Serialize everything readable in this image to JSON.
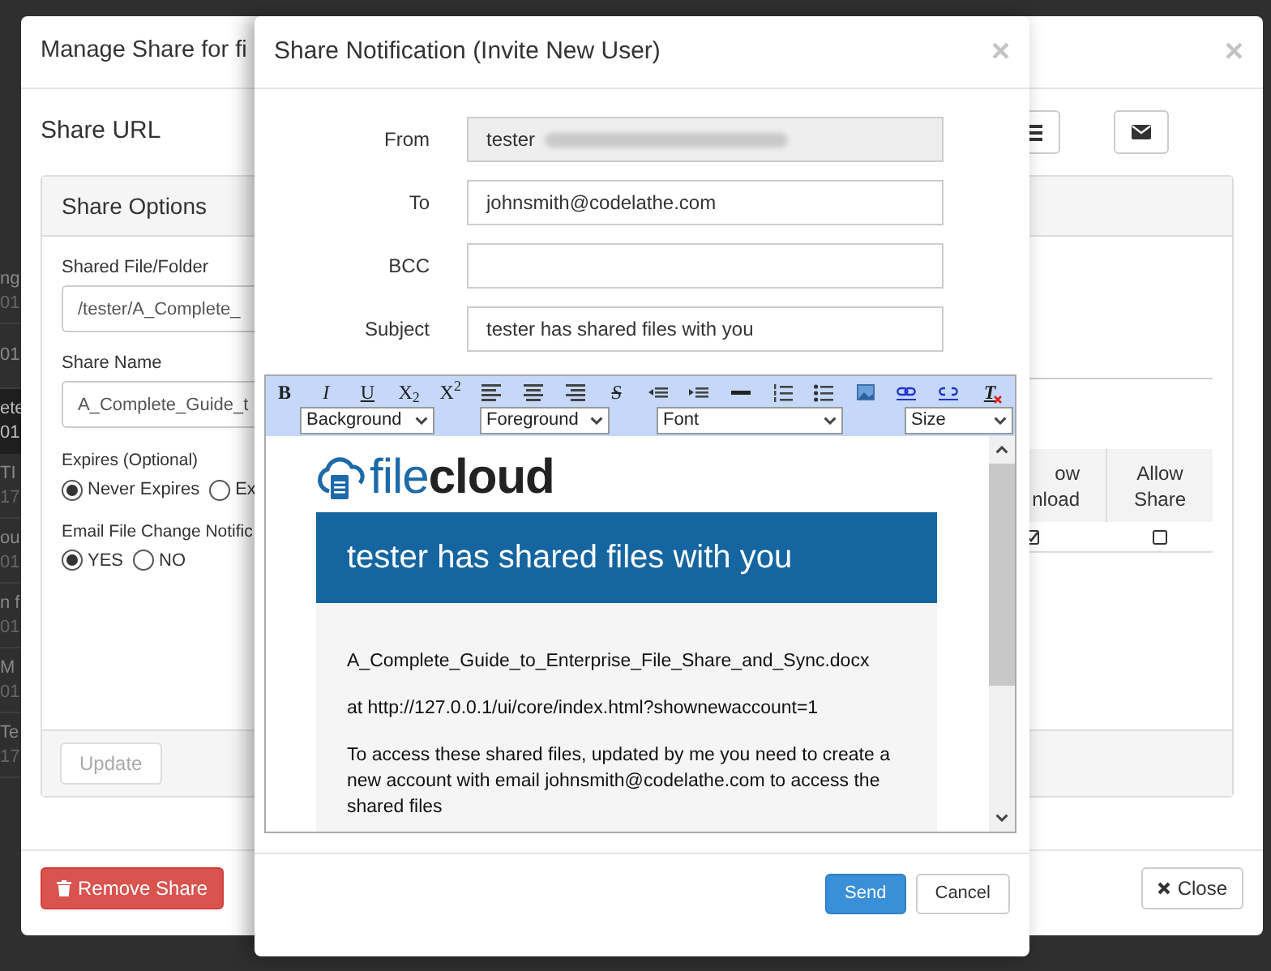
{
  "background_list": {
    "rows": [
      {
        "lines": [
          "ng",
          "01"
        ],
        "selected": false
      },
      {
        "lines": [
          "01"
        ],
        "selected": false
      },
      {
        "lines": [
          "ete",
          "01"
        ],
        "selected": true
      },
      {
        "lines": [
          "TI",
          "17"
        ],
        "selected": false
      },
      {
        "lines": [
          "ou",
          "01"
        ],
        "selected": false
      },
      {
        "lines": [
          "n f",
          "01"
        ],
        "selected": false
      },
      {
        "lines": [
          "M",
          "01"
        ],
        "selected": false
      },
      {
        "lines": [
          "Te",
          "17"
        ],
        "selected": false
      }
    ]
  },
  "manage_share": {
    "title": "Manage Share for fi",
    "close": "×",
    "share_url_label": "Share URL",
    "url_buttons": [
      {
        "kind": "list"
      },
      {
        "kind": "envelope"
      }
    ],
    "share_options": {
      "title": "Share Options",
      "fields": [
        {
          "label": "Shared File/Folder",
          "value": "/tester/A_Complete_"
        },
        {
          "label": "Share Name",
          "value": "A_Complete_Guide_t"
        }
      ],
      "radio_groups": [
        {
          "label": "Expires (Optional)",
          "options": [
            {
              "label": "Never Expires",
              "selected": true
            },
            {
              "label": "Ex",
              "selected": false
            }
          ]
        },
        {
          "label": "Email File Change Notific",
          "options": [
            {
              "label": "YES",
              "selected": true
            },
            {
              "label": "NO",
              "selected": false
            }
          ]
        }
      ],
      "permissions_table": {
        "columns": [
          {
            "lines": [
              "ow",
              "nload"
            ]
          },
          {
            "lines": [
              "Allow",
              "Share"
            ]
          }
        ],
        "row": [
          {
            "checked": true
          },
          {
            "checked": false
          }
        ]
      },
      "update_button": {
        "label": "Update",
        "disabled": true
      }
    },
    "remove_button": "Remove Share",
    "close_button": "Close"
  },
  "share_notification": {
    "title": "Share Notification (Invite New User)",
    "close": "×",
    "fields": [
      {
        "label": "From",
        "value": "tester",
        "disabled": true,
        "redacted": true
      },
      {
        "label": "To",
        "value": "johnsmith@codelathe.com",
        "disabled": false,
        "redacted": false
      },
      {
        "label": "BCC",
        "disabled": false,
        "redacted": false
      },
      {
        "label": "Subject",
        "value": "tester has shared files with you",
        "disabled": false,
        "redacted": false
      }
    ],
    "editor": {
      "toolbar": [
        {
          "kind": "bold",
          "glyph": "B"
        },
        {
          "kind": "italic",
          "glyph": "I"
        },
        {
          "kind": "underline",
          "glyph": "U"
        },
        {
          "kind": "subscript",
          "glyph": "X$_{2}$"
        },
        {
          "kind": "superscript",
          "glyph": "X$^{2}$"
        },
        {
          "kind": "align-left"
        },
        {
          "kind": "align-center"
        },
        {
          "kind": "align-right"
        },
        {
          "kind": "strike",
          "glyph": "S"
        },
        {
          "kind": "outdent"
        },
        {
          "kind": "indent"
        },
        {
          "kind": "rule"
        },
        {
          "kind": "numbered-list"
        },
        {
          "kind": "bullet-list"
        },
        {
          "kind": "image"
        },
        {
          "kind": "link"
        },
        {
          "kind": "unlink"
        },
        {
          "kind": "clear-format",
          "glyph": "T"
        }
      ],
      "selects": [
        "Background",
        "Foreground",
        "Font",
        "Size"
      ],
      "content": {
        "logo": {
          "light": "file",
          "bold": "cloud"
        },
        "banner": "tester has shared files with you",
        "paragraphs": [
          "A_Complete_Guide_to_Enterprise_File_Share_and_Sync.docx",
          "at http://127.0.0.1/ui/core/index.html?shownewaccount=1",
          "To access these shared files, updated by me you need to create a new account with email johnsmith@codelathe.com to access the shared files"
        ]
      }
    },
    "buttons": [
      {
        "label": "Send",
        "kind": "primary"
      },
      {
        "label": "Cancel",
        "kind": "default"
      }
    ]
  }
}
